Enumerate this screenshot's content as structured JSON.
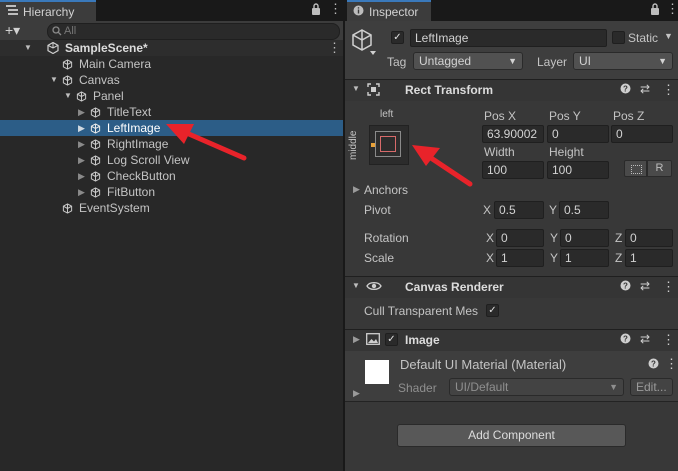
{
  "hierarchy": {
    "tab_label": "Hierarchy",
    "search_placeholder": "All",
    "add_label": "+▾",
    "scene_name": "SampleScene*",
    "items": [
      {
        "label": "Main Camera"
      },
      {
        "label": "Canvas"
      },
      {
        "label": "Panel"
      },
      {
        "label": "TitleText"
      },
      {
        "label": "LeftImage"
      },
      {
        "label": "RightImage"
      },
      {
        "label": "Log Scroll View"
      },
      {
        "label": "CheckButton"
      },
      {
        "label": "FitButton"
      },
      {
        "label": "EventSystem"
      }
    ]
  },
  "inspector": {
    "tab_label": "Inspector",
    "object_name": "LeftImage",
    "static_label": "Static",
    "tag_label": "Tag",
    "tag_value": "Untagged",
    "layer_label": "Layer",
    "layer_value": "UI",
    "rect_transform": {
      "title": "Rect Transform",
      "anchor_h_label": "left",
      "anchor_v_label": "middle",
      "posx_label": "Pos X",
      "posx": "63.90002",
      "posy_label": "Pos Y",
      "posy": "0",
      "posz_label": "Pos Z",
      "posz": "0",
      "width_label": "Width",
      "width": "100",
      "height_label": "Height",
      "height": "100",
      "r_label": "R",
      "anchors_label": "Anchors",
      "pivot_label": "Pivot",
      "pivot_x": "0.5",
      "pivot_y": "0.5",
      "rotation_label": "Rotation",
      "rot_x": "0",
      "rot_y": "0",
      "rot_z": "0",
      "scale_label": "Scale",
      "scale_x": "1",
      "scale_y": "1",
      "scale_z": "1",
      "x": "X",
      "y": "Y",
      "z": "Z"
    },
    "canvas_renderer": {
      "title": "Canvas Renderer",
      "cull_label": "Cull Transparent Mes"
    },
    "image": {
      "title": "Image",
      "material_name": "Default UI Material (Material)",
      "shader_label": "Shader",
      "shader_value": "UI/Default",
      "edit_label": "Edit..."
    },
    "add_component_label": "Add Component"
  },
  "colors": {
    "selection": "#2c5d87",
    "annotation_arrow": "#e8232a"
  }
}
